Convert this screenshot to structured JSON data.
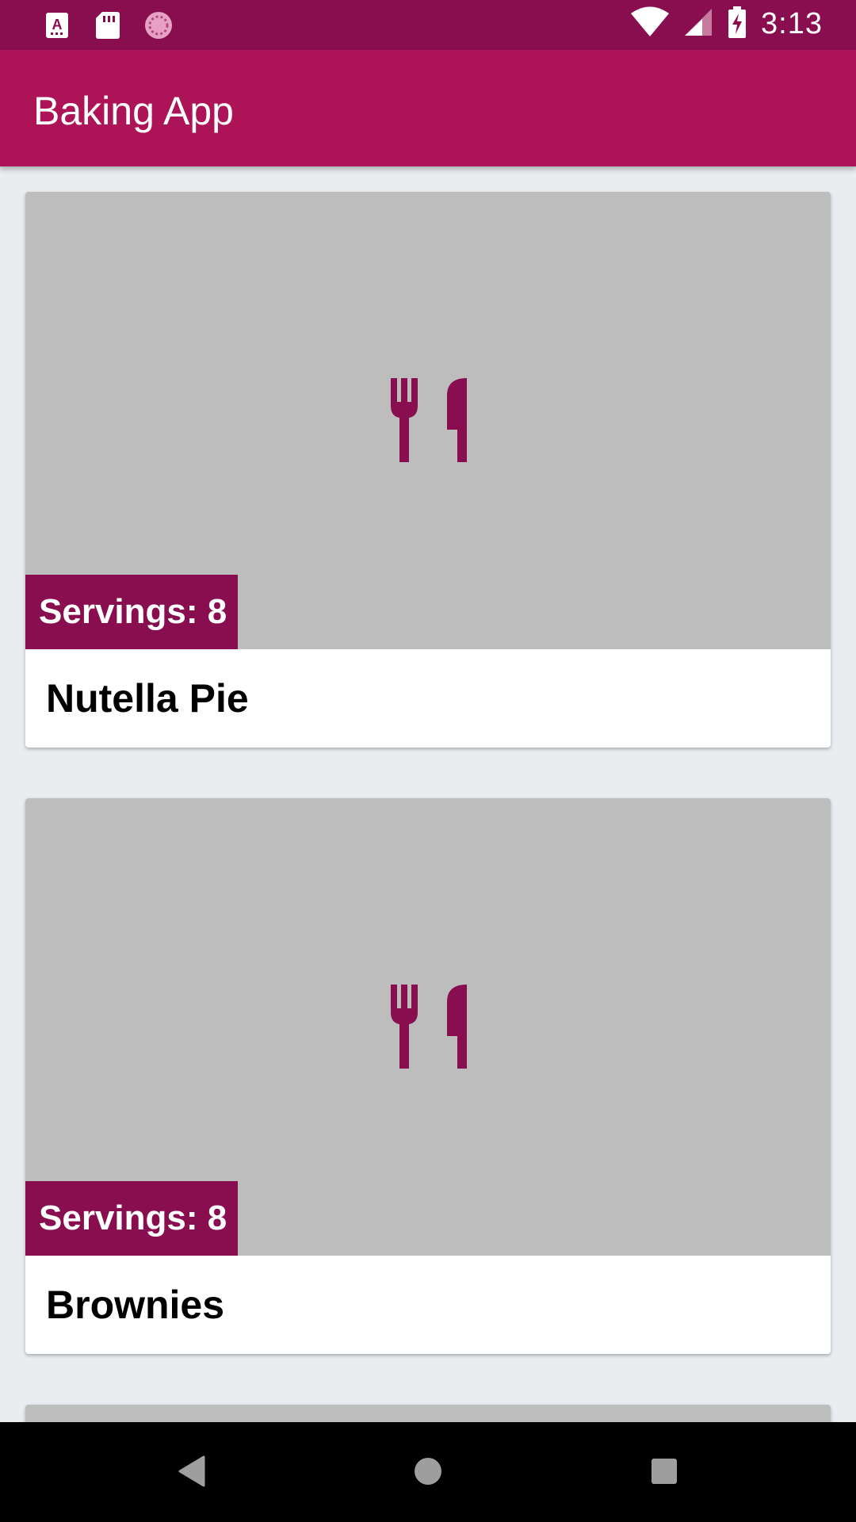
{
  "status_bar": {
    "time": "3:13",
    "left_icons": [
      "app-a-icon",
      "sd-card-icon",
      "sync-icon"
    ],
    "right_icons": [
      "wifi-icon",
      "signal-icon",
      "battery-charging-icon"
    ]
  },
  "app_bar": {
    "title": "Baking App"
  },
  "recipes": [
    {
      "servings_label": "Servings: 8",
      "name": "Nutella Pie",
      "icon": "restaurant-icon"
    },
    {
      "servings_label": "Servings: 8",
      "name": "Brownies",
      "icon": "restaurant-icon"
    }
  ],
  "colors": {
    "status_bar": "#880E4F",
    "app_bar": "#AD1457",
    "accent": "#880E4F",
    "card_media": "#BDBDBD",
    "background": "#E9EDF0"
  },
  "nav_bar": {
    "buttons": [
      "back-icon",
      "home-icon",
      "recents-icon"
    ]
  }
}
